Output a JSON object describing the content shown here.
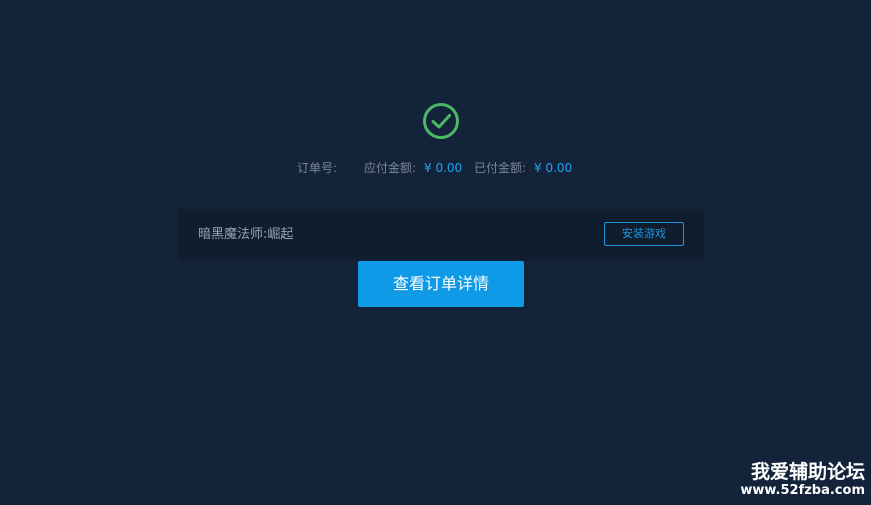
{
  "order_summary": {
    "order_number_label": "订单号:",
    "payable_label": "应付金额:",
    "payable_value": "¥ 0.00",
    "paid_label": "已付金额:",
    "paid_value": "¥ 0.00"
  },
  "game": {
    "name": "暗黑魔法师:崛起",
    "install_label": "安装游戏"
  },
  "actions": {
    "view_order_label": "查看订单详情"
  },
  "watermark": {
    "title": "我爱辅助论坛",
    "url": "www.52fzba.com"
  },
  "colors": {
    "background": "#13233a",
    "success": "#4cb865",
    "accent": "#0e9ae6",
    "amount": "#1fa3ef"
  },
  "icons": {
    "status": "check-circle-icon"
  }
}
